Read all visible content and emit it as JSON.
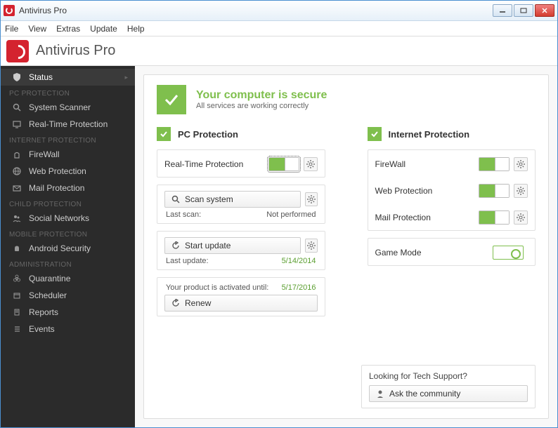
{
  "window": {
    "title": "Antivirus Pro"
  },
  "menu": {
    "file": "File",
    "view": "View",
    "extras": "Extras",
    "update": "Update",
    "help": "Help"
  },
  "brand": {
    "title": "Antivirus Pro"
  },
  "sidebar": {
    "status": "Status",
    "heads": {
      "pc": "PC PROTECTION",
      "internet": "INTERNET PROTECTION",
      "child": "CHILD PROTECTION",
      "mobile": "MOBILE PROTECTION",
      "admin": "ADMINISTRATION"
    },
    "items": {
      "scanner": "System Scanner",
      "realtime": "Real-Time Protection",
      "firewall": "FireWall",
      "web": "Web Protection",
      "mail": "Mail Protection",
      "social": "Social Networks",
      "android": "Android Security",
      "quarantine": "Quarantine",
      "scheduler": "Scheduler",
      "reports": "Reports",
      "events": "Events"
    }
  },
  "status": {
    "title": "Your computer is secure",
    "subtitle": "All services are working correctly"
  },
  "pc": {
    "title": "PC Protection",
    "realtime": "Real-Time Protection",
    "scan_btn": "Scan system",
    "last_scan_label": "Last scan:",
    "last_scan_value": "Not performed",
    "update_btn": "Start update",
    "last_update_label": "Last update:",
    "last_update_value": "5/14/2014",
    "activated_label": "Your product is activated until:",
    "activated_value": "5/17/2016",
    "renew_btn": "Renew"
  },
  "internet": {
    "title": "Internet Protection",
    "firewall": "FireWall",
    "web": "Web Protection",
    "mail": "Mail Protection",
    "gamemode": "Game Mode"
  },
  "support": {
    "question": "Looking for Tech Support?",
    "ask": "Ask the community"
  }
}
